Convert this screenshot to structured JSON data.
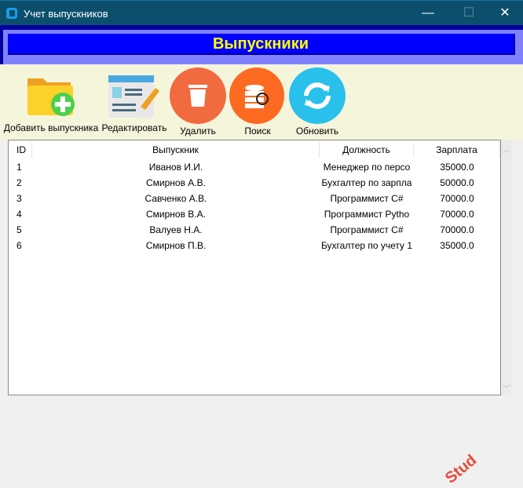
{
  "window": {
    "title": "Учет выпускников",
    "minimize": "—",
    "maximize": "☐",
    "close": "✕"
  },
  "banner": {
    "title": "Выпускники"
  },
  "toolbar": {
    "add": "Добавить выпускника",
    "edit": "Редактировать",
    "delete": "Удалить",
    "search": "Поиск",
    "refresh": "Обновить"
  },
  "table": {
    "columns": [
      "ID",
      "Выпускник",
      "Должность",
      "Зарплата"
    ],
    "rows": [
      [
        "1",
        "Иванов И.И.",
        "Менеджер по персо",
        "35000.0"
      ],
      [
        "2",
        "Смирнов А.В.",
        "Бухгалтер по зарпла",
        "50000.0"
      ],
      [
        "3",
        "Савченко А.В.",
        "Программист C#",
        "70000.0"
      ],
      [
        "4",
        "Смирнов В.А.",
        "Программист Pytho",
        "70000.0"
      ],
      [
        "5",
        "Валуев Н.А.",
        "Программист C#",
        "70000.0"
      ],
      [
        "6",
        "Смирнов П.В.",
        "Бухгалтер по учету 1",
        "35000.0"
      ]
    ]
  },
  "watermark": "Stud"
}
